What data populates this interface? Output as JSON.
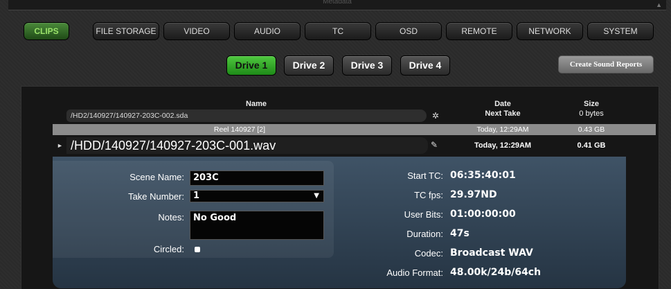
{
  "topbar": {
    "title": "Metadata"
  },
  "tabs": [
    "CLIPS",
    "FILE STORAGE",
    "VIDEO",
    "AUDIO",
    "TC",
    "OSD",
    "REMOTE",
    "NETWORK",
    "SYSTEM"
  ],
  "drives": [
    "Drive 1",
    "Drive 2",
    "Drive 3",
    "Drive 4"
  ],
  "report_button": "Create Sound Reports",
  "columns": {
    "name": "Name",
    "date": "Date",
    "date_sub": "Next Take",
    "size": "Size",
    "size_sub": "0 bytes"
  },
  "current_path": "/HD2/140927/140927-203C-002.sda",
  "reel": {
    "label": "Reel 140927 [2]",
    "date": "Today, 12:29AM",
    "size": "0.43 GB"
  },
  "file": {
    "path": "/HDD/140927/140927-203C-001.wav",
    "date": "Today, 12:29AM",
    "size": "0.41 GB"
  },
  "metadata": {
    "scene_label": "Scene Name:",
    "scene_value": "203C",
    "take_label": "Take Number:",
    "take_value": "1",
    "notes_label": "Notes:",
    "notes_value": "No Good",
    "circled_label": "Circled:"
  },
  "info": [
    {
      "label": "Start TC:",
      "value": "06:35:40:01"
    },
    {
      "label": "TC fps:",
      "value": "29.97ND"
    },
    {
      "label": "User Bits:",
      "value": "01:00:00:00"
    },
    {
      "label": "Duration:",
      "value": "47s"
    },
    {
      "label": "Codec:",
      "value": "Broadcast WAV"
    },
    {
      "label": "Audio Format:",
      "value": "48.00k/24b/64ch"
    }
  ],
  "colors": {
    "accent_green": "#4fc83f",
    "panel_blue": "#3f5366"
  }
}
